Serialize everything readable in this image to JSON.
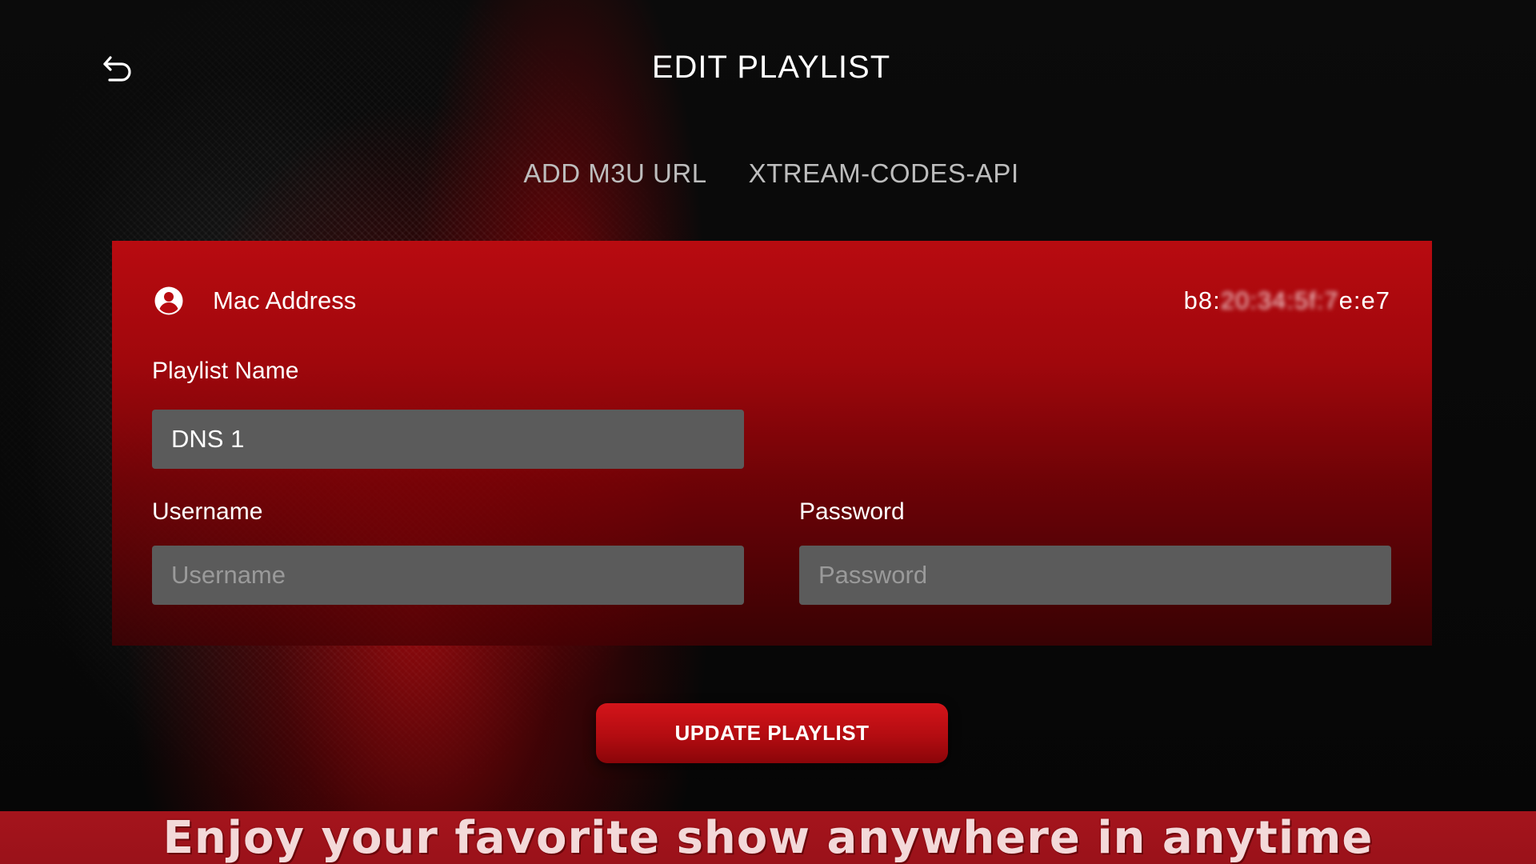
{
  "header": {
    "title": "EDIT PLAYLIST",
    "back_icon": "undo-arrow-icon"
  },
  "tabs": [
    {
      "label": "ADD M3U URL"
    },
    {
      "label": "XTREAM-CODES-API"
    }
  ],
  "form": {
    "mac": {
      "icon": "account-circle-icon",
      "label": "Mac Address",
      "value_prefix": "b8:",
      "value_obscured": "20:34:5f:7",
      "value_suffix": "e:e7"
    },
    "playlist_name": {
      "label": "Playlist Name",
      "value": "DNS 1",
      "placeholder": ""
    },
    "username": {
      "label": "Username",
      "value": "",
      "placeholder": "Username"
    },
    "password": {
      "label": "Password",
      "value": "",
      "placeholder": "Password"
    }
  },
  "actions": {
    "update_label": "UPDATE PLAYLIST"
  },
  "banner": {
    "text": "Enjoy your favorite show anywhere in anytime"
  },
  "colors": {
    "accent": "#b80b10",
    "banner": "#a5141c",
    "input_bg": "#5b5b5b"
  }
}
